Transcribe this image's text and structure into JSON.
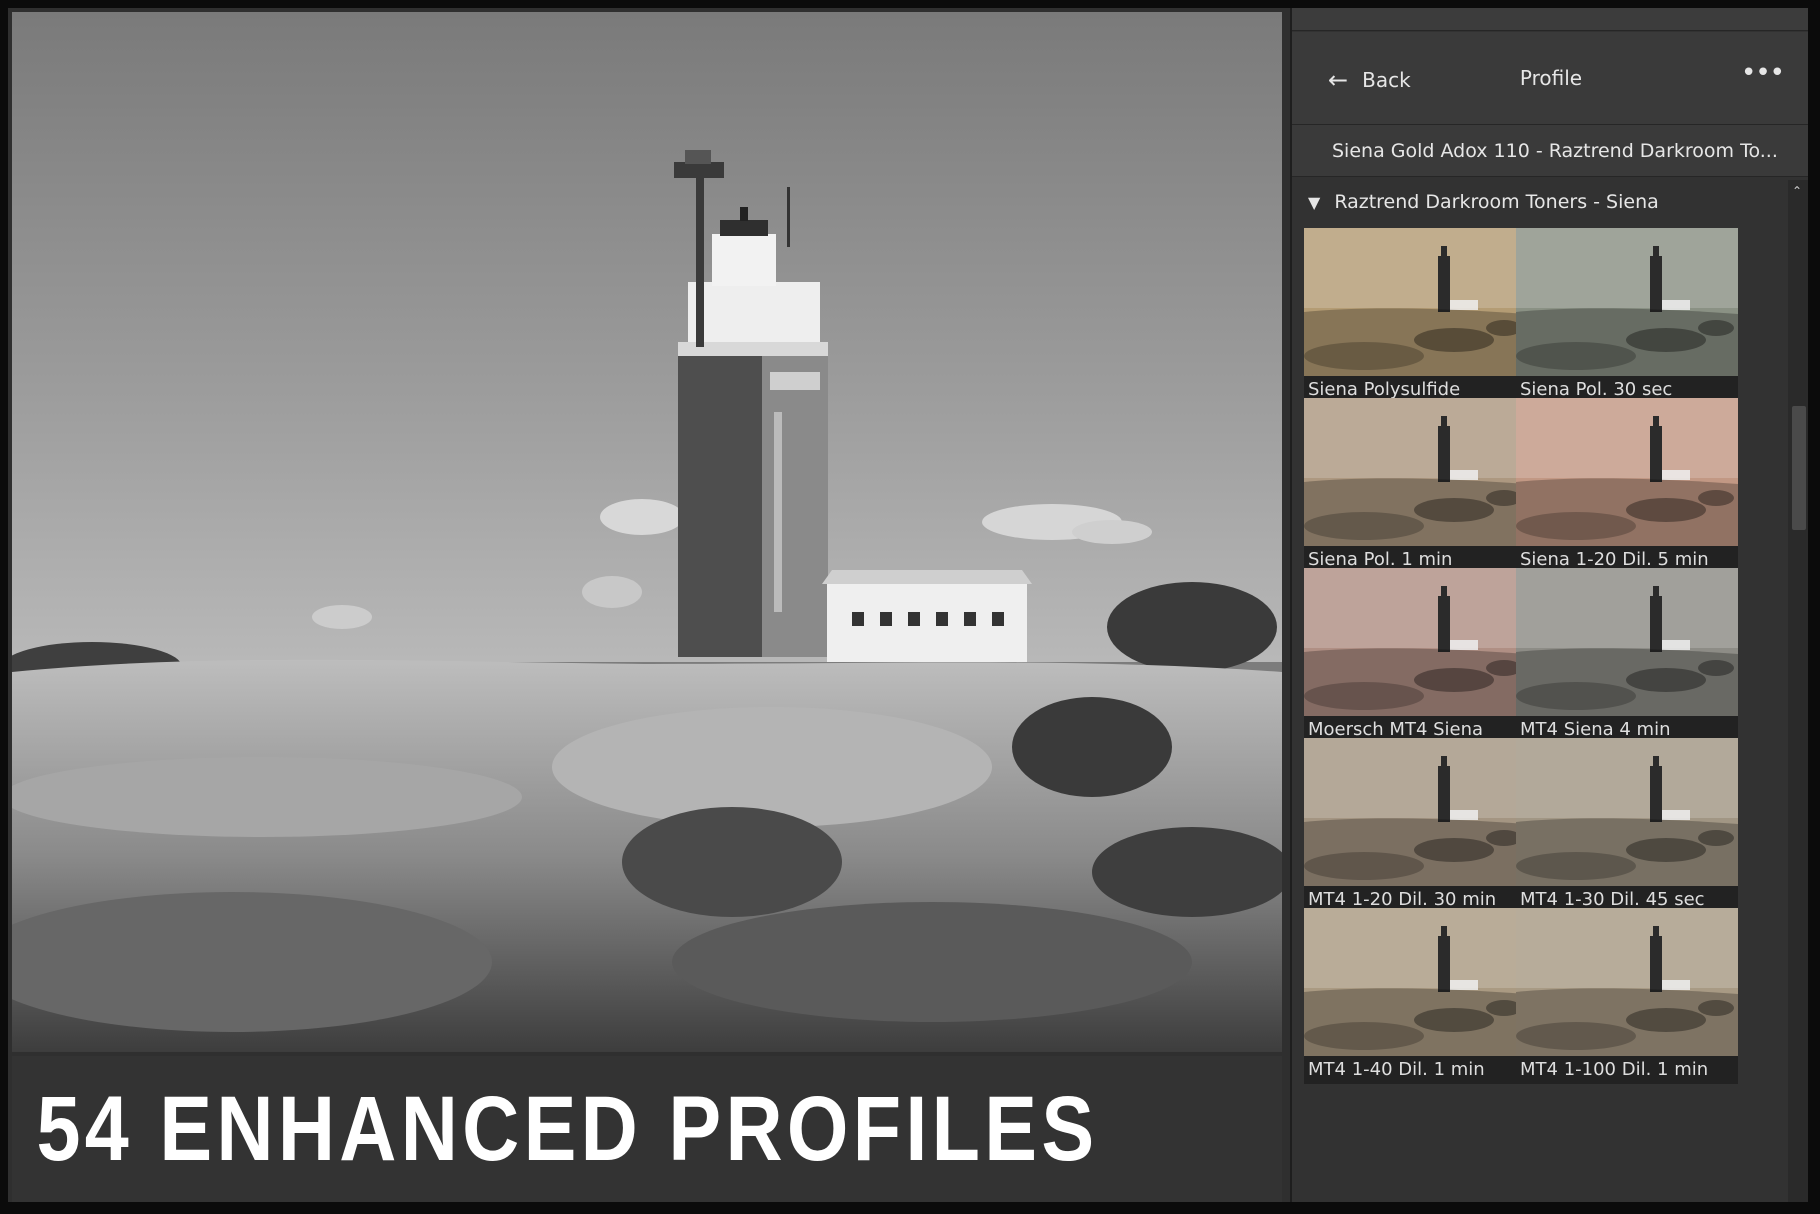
{
  "banner": {
    "text": "54 ENHANCED PROFILES"
  },
  "panel": {
    "back_label": "Back",
    "back_icon": "left-arrow",
    "title": "Profile",
    "more_icon": "ellipsis",
    "profile_name": "Siena Gold Adox 110 - Raztrend Darkroom To...",
    "group": {
      "expanded_icon": "triangle-down",
      "label": "Raztrend Darkroom Toners - Siena",
      "items": [
        {
          "label": "Siena Polysulfide",
          "tint": "#b49c74"
        },
        {
          "label": "Siena Pol. 30 sec",
          "tint": "#8a9184"
        },
        {
          "label": "Siena Pol. 1 min",
          "tint": "#ad9880"
        },
        {
          "label": "Siena 1-20 Dil. 5 min",
          "tint": "#c29884"
        },
        {
          "label": "Moersch MT4 Siena",
          "tint": "#b08f84"
        },
        {
          "label": "MT4 Siena 4 min",
          "tint": "#8d8c86"
        },
        {
          "label": "MT4 1-20 Dil. 30 min",
          "tint": "#a49582"
        },
        {
          "label": "MT4 1-30 Dil. 45 sec",
          "tint": "#a19684"
        },
        {
          "label": "MT4 1-40 Dil. 1 min",
          "tint": "#aa9a82"
        },
        {
          "label": "MT4 1-100 Dil. 1 min",
          "tint": "#a89a84"
        }
      ]
    }
  }
}
